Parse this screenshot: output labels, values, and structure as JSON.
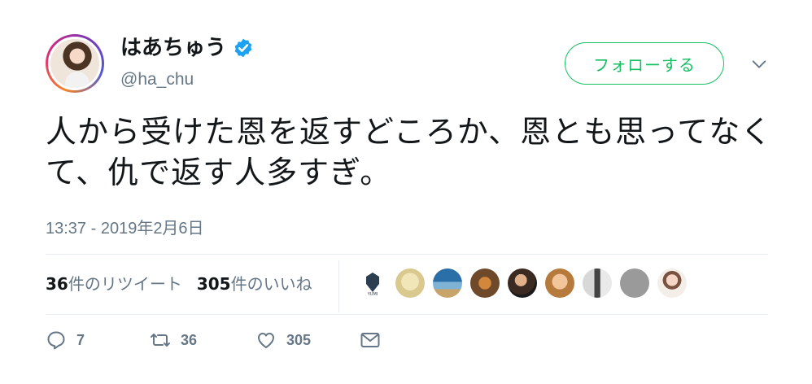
{
  "user": {
    "display_name": "はあちゅう",
    "handle": "@ha_chu"
  },
  "follow_label": "フォローする",
  "tweet_text": "人から受けた恩を返すどころか、恩とも思ってなくて、仇で返す人多すぎ。",
  "timestamp": "13:37 - 2019年2月6日",
  "stats": {
    "retweets_count": "36",
    "retweets_label": "件のリツイート",
    "likes_count": "305",
    "likes_label": "件のいいね"
  },
  "actions": {
    "reply_count": "7",
    "retweet_count": "36",
    "like_count": "305"
  },
  "colors": {
    "follow_green": "#17bf63",
    "secondary_text": "#657786",
    "verified_blue": "#1da1f2"
  },
  "icons": [
    "verified-icon",
    "chevron-down-icon",
    "reply-icon",
    "retweet-icon",
    "heart-icon",
    "message-icon"
  ]
}
